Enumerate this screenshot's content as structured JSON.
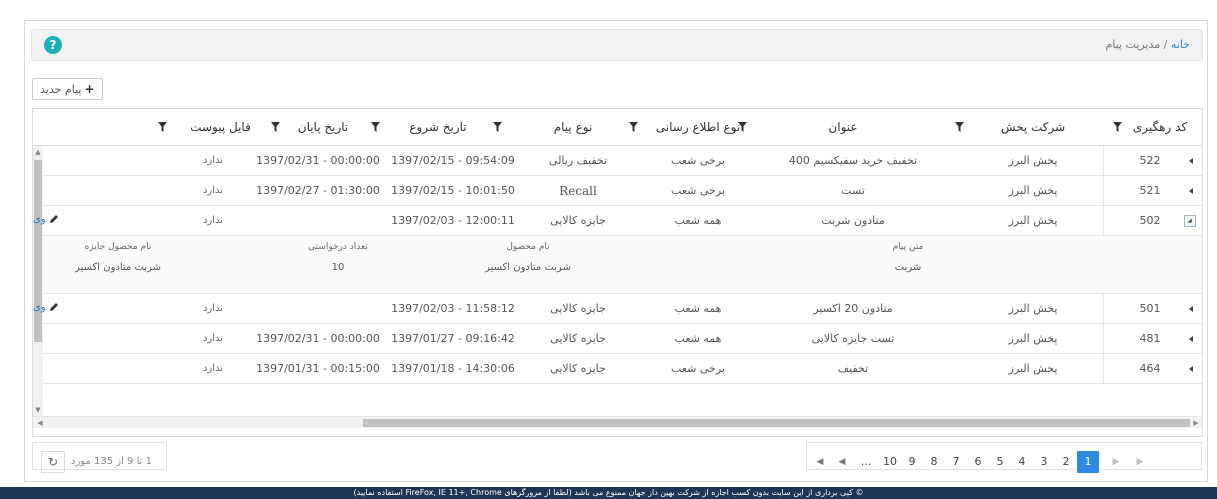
{
  "breadcrumb": {
    "home": "خانه",
    "separator": "/",
    "current": "مدیریت پیام"
  },
  "help_glyph": "?",
  "toolbar": {
    "new_message_label": "پیام جدید"
  },
  "columns": {
    "tracking_code": "کد رهگیری",
    "distribution_company": "شرکت پخش",
    "title": "عنوان",
    "notification_type": "نوع اطلاع رسانی",
    "message_type": "نوع پیام",
    "start_date": "تاریخ شروع",
    "end_date": "تاریخ پایان",
    "attachment": "فایل پیوست"
  },
  "rows": [
    {
      "code": "522",
      "company": "پخش البرز",
      "title": "تخفیف خرید سفیکسیم 400",
      "notify": "برخی شعب",
      "type": "تخفیف ریالی",
      "start": "1397/02/15 - 09:54:09",
      "end": "1397/02/31 - 00:00:00",
      "attachment": "ندارد",
      "edit": ""
    },
    {
      "code": "521",
      "company": "پخش البرز",
      "title": "تست",
      "notify": "برخی شعب",
      "type": "Recall",
      "start": "1397/02/15 - 10:01:50",
      "end": "1397/02/27 - 01:30:00",
      "attachment": "ندارد",
      "edit": ""
    },
    {
      "code": "502",
      "company": "پخش البرز",
      "title": "متادون شربت",
      "notify": "همه شعب",
      "type": "جایزه کالایی",
      "start": "1397/02/03 - 12:00:11",
      "end": "",
      "attachment": "ندارد",
      "edit": "وی"
    },
    {
      "code": "501",
      "company": "پخش البرز",
      "title": "متادون 20 اکسیر",
      "notify": "همه شعب",
      "type": "جایزه کالایی",
      "start": "1397/02/03 - 11:58:12",
      "end": "",
      "attachment": "ندارد",
      "edit": "وی"
    },
    {
      "code": "481",
      "company": "پخش البرز",
      "title": "تست جایزه کالایی",
      "notify": "همه شعب",
      "type": "جایزه کالایی",
      "start": "1397/01/27 - 09:16:42",
      "end": "1397/02/31 - 00:00:00",
      "attachment": "ندارد",
      "edit": ""
    },
    {
      "code": "464",
      "company": "پخش البرز",
      "title": "تخفیف",
      "notify": "برخی شعب",
      "type": "جایزه کالایی",
      "start": "1397/01/18 - 14:30:06",
      "end": "1397/01/31 - 00:15:00",
      "attachment": "ندارد",
      "edit": ""
    }
  ],
  "detail": {
    "message_text_label": "متن پیام",
    "message_text": "شربت",
    "product_name_label": "نام محصول",
    "product_name": "شربت متادون اکسیر",
    "request_count_label": "تعداد درخواستی",
    "request_count": "10",
    "prize_product_label": "نام محصول جایزه",
    "prize_product": "شربت متادون اکسیر"
  },
  "pagination": {
    "pages": [
      "1",
      "2",
      "3",
      "4",
      "5",
      "6",
      "7",
      "8",
      "9",
      "10"
    ],
    "active_page": "1",
    "ellipsis": "...",
    "info": "1 تا 9 از 135 مورد"
  },
  "footer": {
    "text": "© کپی برداری از این سایت بدون کسب اجازه از شرکت بهین داز جهان ممنوع می باشد (لطفا از مرورگرهای FireFox, IE 11+, Chrome استفاده نمایید)"
  },
  "colors": {
    "accent": "#2c8ae0",
    "help": "#1bb0b8",
    "footer": "#1d3656",
    "link": "#2f7ec1"
  }
}
